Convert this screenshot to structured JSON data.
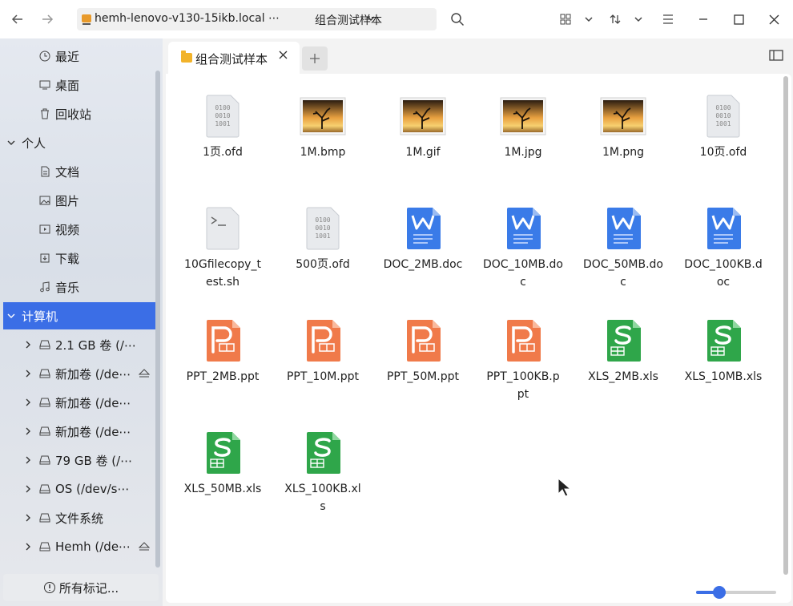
{
  "titlebar": {
    "host": "hemh-lenovo-v130-15ikb.local ⋯",
    "breadcrumb": "组合测试样本"
  },
  "sidebar": {
    "items": [
      {
        "label": "最近",
        "icon": "clock-icon"
      },
      {
        "label": "桌面",
        "icon": "desktop-icon"
      },
      {
        "label": "回收站",
        "icon": "trash-icon"
      },
      {
        "label": "个人",
        "icon": "chevron-down-icon"
      },
      {
        "label": "文档",
        "icon": "document-icon"
      },
      {
        "label": "图片",
        "icon": "picture-icon"
      },
      {
        "label": "视频",
        "icon": "video-icon"
      },
      {
        "label": "下载",
        "icon": "download-icon"
      },
      {
        "label": "音乐",
        "icon": "music-icon"
      },
      {
        "label": "计算机",
        "icon": "chevron-down-icon"
      },
      {
        "label": "2.1 GB 卷 (/⋯",
        "icon": "drive-icon"
      },
      {
        "label": "新加卷 (/de⋯",
        "icon": "drive-icon"
      },
      {
        "label": "新加卷 (/de⋯",
        "icon": "drive-icon"
      },
      {
        "label": "新加卷 (/de⋯",
        "icon": "drive-icon"
      },
      {
        "label": "79 GB 卷 (/⋯",
        "icon": "drive-icon"
      },
      {
        "label": "OS (/dev/s⋯",
        "icon": "drive-icon"
      },
      {
        "label": "文件系统",
        "icon": "drive-icon"
      },
      {
        "label": "Hemh (/de⋯",
        "icon": "drive-icon"
      }
    ],
    "tags_button": "所有标记..."
  },
  "tab": {
    "label": "组合测试样本"
  },
  "files": [
    {
      "name": "1页.ofd",
      "type": "ofd"
    },
    {
      "name": "1M.bmp",
      "type": "image"
    },
    {
      "name": "1M.gif",
      "type": "image"
    },
    {
      "name": "1M.jpg",
      "type": "image"
    },
    {
      "name": "1M.png",
      "type": "image"
    },
    {
      "name": "10页.ofd",
      "type": "ofd"
    },
    {
      "name": "10Gfilecopy_test.sh",
      "type": "sh"
    },
    {
      "name": "500页.ofd",
      "type": "ofd"
    },
    {
      "name": "DOC_2MB.doc",
      "type": "doc"
    },
    {
      "name": "DOC_10MB.doc",
      "type": "doc"
    },
    {
      "name": "DOC_50MB.doc",
      "type": "doc"
    },
    {
      "name": "DOC_100KB.doc",
      "type": "doc"
    },
    {
      "name": "PPT_2MB.ppt",
      "type": "ppt"
    },
    {
      "name": "PPT_10M.ppt",
      "type": "ppt"
    },
    {
      "name": "PPT_50M.ppt",
      "type": "ppt"
    },
    {
      "name": "PPT_100KB.ppt",
      "type": "ppt"
    },
    {
      "name": "XLS_2MB.xls",
      "type": "xls"
    },
    {
      "name": "XLS_10MB.xls",
      "type": "xls"
    },
    {
      "name": "XLS_50MB.xls",
      "type": "xls"
    },
    {
      "name": "XLS_100KB.xls",
      "type": "xls"
    }
  ],
  "zoom_slider": {
    "fraction": 0.29
  },
  "colors": {
    "accent": "#3b6ee6",
    "doc": "#3a7be8",
    "ppt": "#f07a4a",
    "xls": "#2fa64a"
  }
}
